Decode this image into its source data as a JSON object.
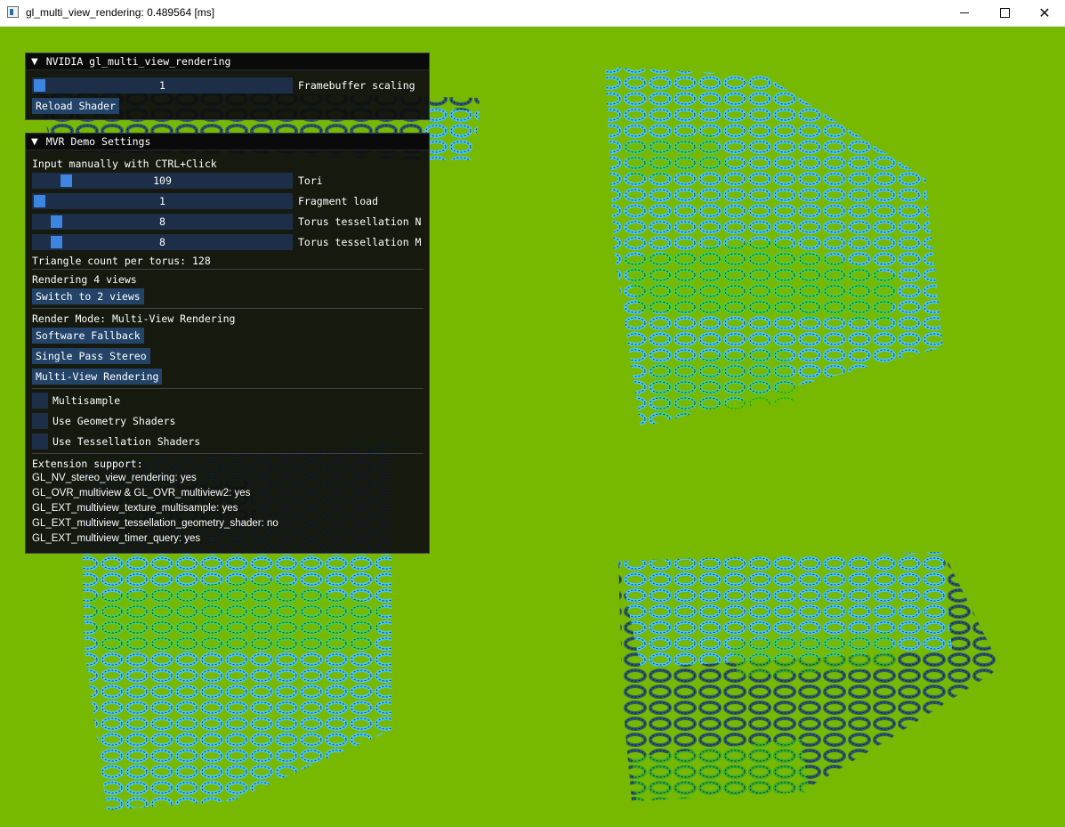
{
  "window": {
    "title": "gl_multi_view_rendering: 0.489564 [ms]",
    "app_icon": "window-app-icon",
    "controls": [
      "minimize-icon",
      "maximize-icon",
      "close-icon"
    ]
  },
  "colors": {
    "background": "#76b900",
    "panel": "#0f0f0f",
    "accent": "#3d85e0",
    "frame": "#1d2f48",
    "button": "#234468",
    "torus_cyan": "#5fd3ff",
    "torus_green": "#3fd21a"
  },
  "panel1": {
    "title": "NVIDIA gl_multi_view_rendering",
    "framebuffer_scaling": {
      "label": "Framebuffer scaling",
      "value": "1",
      "fraction": 0.0
    },
    "reload_shader_label": "Reload Shader"
  },
  "panel2": {
    "title": "MVR Demo Settings",
    "hint": "Input manually with CTRL+Click",
    "tori": {
      "label": "Tori",
      "value": "109",
      "fraction": 0.11
    },
    "fragment_load": {
      "label": "Fragment load",
      "value": "1",
      "fraction": 0.0
    },
    "torus_n": {
      "label": "Torus tessellation N",
      "value": "8",
      "fraction": 0.07
    },
    "torus_m": {
      "label": "Torus tessellation M",
      "value": "8",
      "fraction": 0.07
    },
    "triangle_count": "Triangle count per torus: 128",
    "rendering_views": "Rendering 4 views",
    "switch_views_label": "Switch to 2 views",
    "render_mode": "Render Mode: Multi-View Rendering",
    "software_fallback_label": "Software Fallback",
    "single_pass_stereo_label": "Single Pass Stereo",
    "multi_view_rendering_label": "Multi-View Rendering",
    "multisample_label": "Multisample",
    "geometry_shaders_label": "Use Geometry Shaders",
    "tessellation_shaders_label": "Use Tessellation Shaders",
    "extension_support": "Extension support:",
    "extensions": [
      "GL_NV_stereo_view_rendering: yes",
      "GL_OVR_multiview & GL_OVR_multiview2: yes",
      "GL_EXT_multiview_texture_multisample: yes",
      "GL_EXT_multiview_tessellation_geometry_shader: no",
      "GL_EXT_multiview_timer_query: yes"
    ]
  }
}
